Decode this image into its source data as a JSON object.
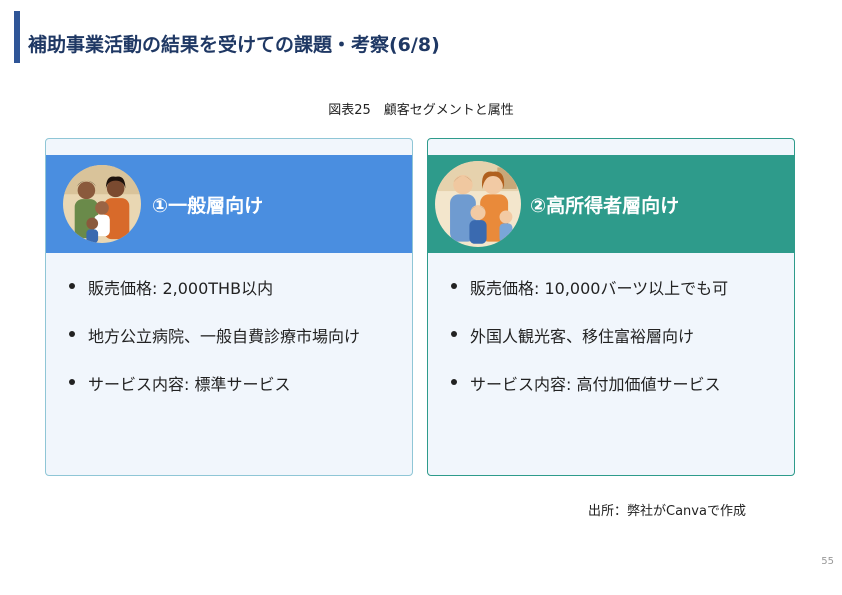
{
  "page": {
    "title": "補助事業活動の結果を受けての課題・考察(6/8)",
    "figure_caption": "図表25　顧客セグメントと属性",
    "source_note": "出所：弊社がCanvaで作成",
    "page_number": "55"
  },
  "cards": [
    {
      "title": "①一般層向け",
      "header_color": "#4a8ee0",
      "image": "family-illustration",
      "bullets": [
        "販売価格: 2,000THB以内",
        "地方公立病院、一般自費診療市場向け",
        "サービス内容:  標準サービス"
      ]
    },
    {
      "title": "②高所得者層向け",
      "header_color": "#2e9b8b",
      "image": "family-illustration",
      "bullets": [
        "販売価格: 10,000バーツ以上でも可",
        "外国人観光客、移住富裕層向け",
        "サービス内容: 高付加価値サービス"
      ]
    }
  ]
}
